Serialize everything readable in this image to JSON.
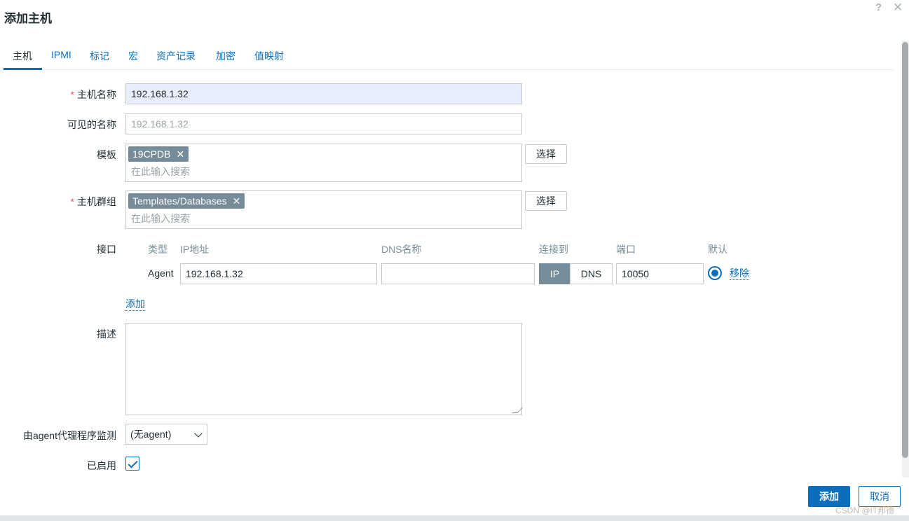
{
  "dialog": {
    "title": "添加主机",
    "help": "?",
    "close": "✕"
  },
  "tabs": [
    {
      "label": "主机"
    },
    {
      "label": "IPMI"
    },
    {
      "label": "标记"
    },
    {
      "label": "宏"
    },
    {
      "label": "资产记录"
    },
    {
      "label": "加密"
    },
    {
      "label": "值映射"
    }
  ],
  "form": {
    "required_mark": "*",
    "host_name": {
      "label": "主机名称",
      "value": "192.168.1.32"
    },
    "visible_name": {
      "label": "可见的名称",
      "placeholder": "192.168.1.32"
    },
    "templates": {
      "label": "模板",
      "chip": "19CPDB",
      "chip_remove": "✕",
      "placeholder": "在此输入搜索",
      "select_button": "选择"
    },
    "host_groups": {
      "label": "主机群组",
      "chip": "Templates/Databases",
      "chip_remove": "✕",
      "placeholder": "在此输入搜索",
      "select_button": "选择"
    },
    "interfaces": {
      "label": "接口",
      "headers": {
        "type": "类型",
        "ip": "IP地址",
        "dns": "DNS名称",
        "connect_to": "连接到",
        "port": "端口",
        "default": "默认"
      },
      "row": {
        "type": "Agent",
        "ip": "192.168.1.32",
        "dns": "",
        "connect_ip": "IP",
        "connect_dns": "DNS",
        "port": "10050",
        "remove": "移除",
        "default_selected": true
      },
      "add": "添加"
    },
    "description": {
      "label": "描述",
      "value": ""
    },
    "proxy": {
      "label": "由agent代理程序监测",
      "selected": "(无agent)"
    },
    "enabled": {
      "label": "已启用",
      "checked": true
    }
  },
  "buttons": {
    "add": "添加",
    "cancel": "取消"
  },
  "watermark": "CSDN @IT邦德",
  "colors": {
    "accent": "#0a6ebd",
    "chip": "#768d99",
    "required": "#e45959",
    "autofill": "#e8eefb"
  }
}
